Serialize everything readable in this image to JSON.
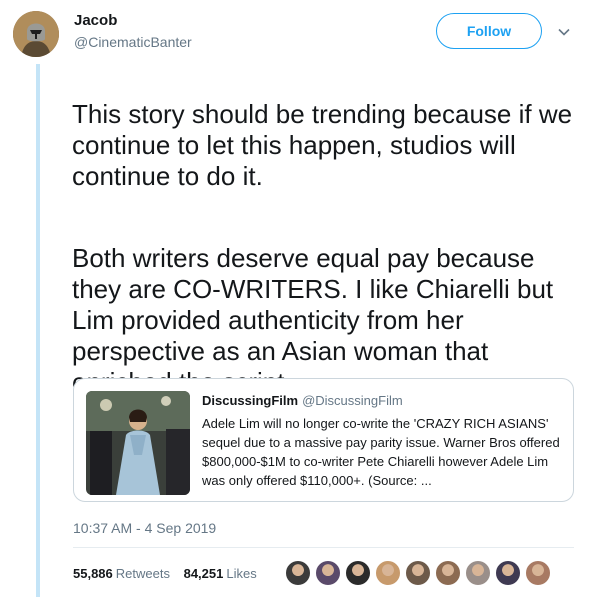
{
  "tweet": {
    "author_name": "Jacob",
    "author_handle": "@CinematicBanter",
    "follow_label": "Follow",
    "paragraphs": [
      "This story should be trending because if we continue to let this happen, studios will continue to do it.",
      "Both writers deserve equal pay because they are CO-WRITERS. I like Chiarelli but Lim provided authenticity from her perspective as an Asian woman that enriched the script."
    ],
    "timestamp": "10:37 AM - 4 Sep 2019"
  },
  "quote": {
    "author_name": "DiscussingFilm",
    "author_handle": "@DiscussingFilm",
    "text": "Adele Lim will no longer co-write the 'CRAZY RICH ASIANS' sequel due to a massive pay parity issue. Warner Bros offered $800,000-$1M to co-writer Pete Chiarelli however Adele Lim was only offered $110,000+. (Source: ..."
  },
  "stats": {
    "retweets_count": "55,886",
    "retweets_label": "Retweets",
    "likes_count": "84,251",
    "likes_label": "Likes"
  },
  "colors": {
    "accent": "#1da1f2",
    "thread_line": "#c4e4f7",
    "secondary_text": "#657786"
  },
  "liker_avatar_colors": [
    "#3b3b3b",
    "#5a4a6a",
    "#2b2b2b",
    "#c79a6c",
    "#6d5a4a",
    "#8c6b52",
    "#9a8f8a",
    "#3f3a52",
    "#a87a63"
  ]
}
